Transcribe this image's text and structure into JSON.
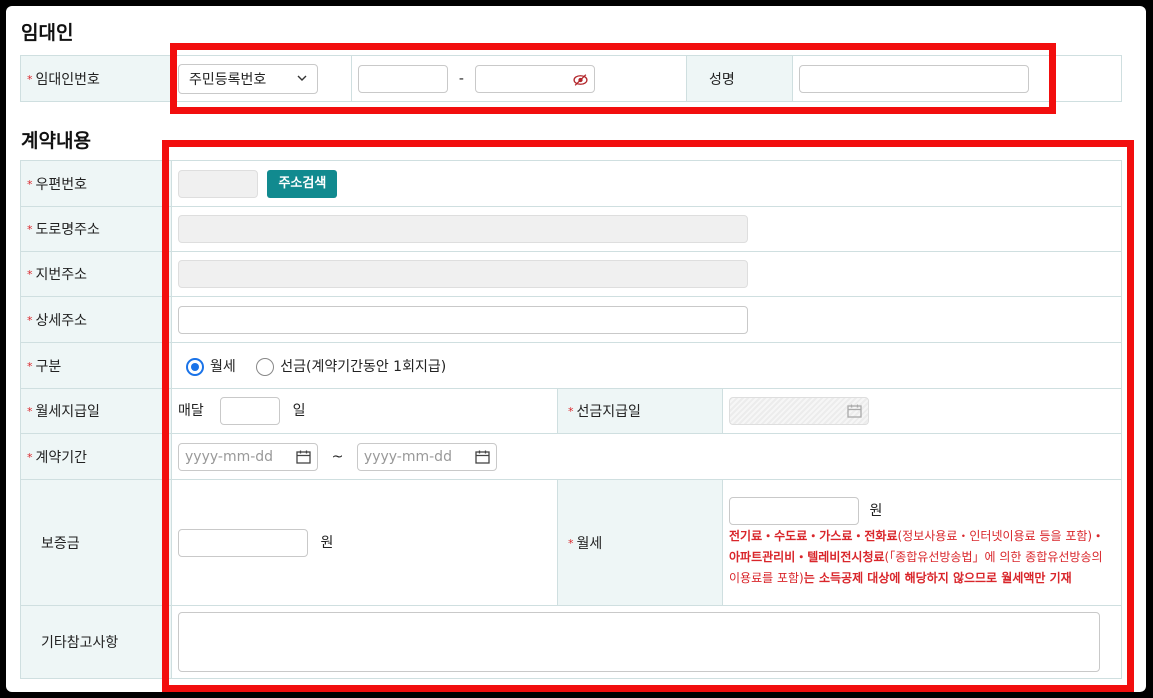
{
  "lessor": {
    "title": "임대인",
    "id_label": "임대인번호",
    "id_type_selected": "주민등록번호",
    "id_dash": "-",
    "name_label": "성명"
  },
  "contract": {
    "title": "계약내용",
    "postal_label": "우편번호",
    "address_search_button": "주소검색",
    "road_address_label": "도로명주소",
    "lot_address_label": "지번주소",
    "detail_address_label": "상세주소",
    "type_label": "구분",
    "type_options": [
      "월세",
      "선금(계약기간동안 1회지급)"
    ],
    "type_selected": "월세",
    "rent_payday_label": "월세지급일",
    "rent_payday_prefix": "매달",
    "rent_payday_suffix": "일",
    "prepay_date_label": "선금지급일",
    "period_label": "계약기간",
    "period_start_placeholder": "yyyy-mm-dd",
    "period_sep": "~",
    "period_end_placeholder": "yyyy-mm-dd",
    "deposit_label": "보증금",
    "deposit_unit": "원",
    "rent_label": "월세",
    "rent_unit": "원",
    "rent_note": {
      "p1": "전기료・수도료・가스료・전화료",
      "p2": "(정보사용료・인터넷이용료 등을 포함)",
      "p3": "・아파트관리비・텔레비전시청료",
      "p4": "(「종합유선방송법」에 의한 종합유선방송의 이용료를 포함)",
      "p5": "는 소득공제 대상에 해당하지 않으므로 월세액만 기재"
    },
    "remarks_label": "기타참고사항"
  },
  "colors": {
    "required_mark": "#d9262b",
    "header_cell_bg": "#eef6f6",
    "button_teal": "#118a8f",
    "highlight_red": "#f20e0e",
    "radio_blue": "#1a73e8"
  },
  "icons": [
    "chevron-down-icon",
    "eye-off-icon",
    "calendar-icon"
  ]
}
